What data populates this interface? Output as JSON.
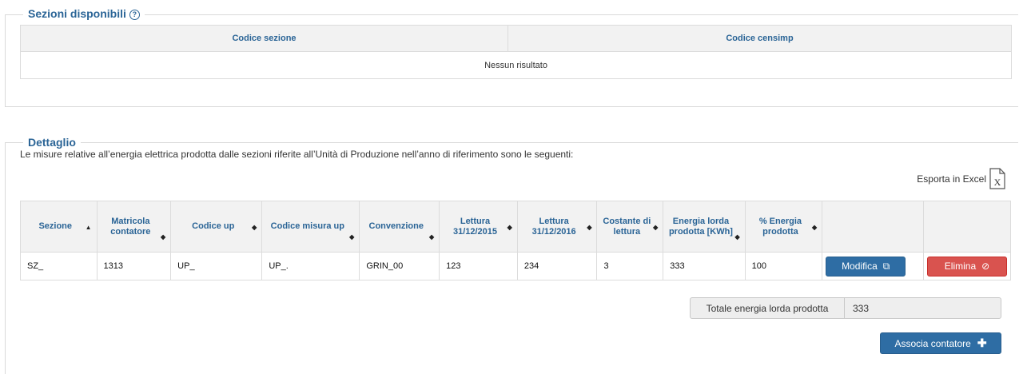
{
  "sezioni": {
    "legend": "Sezioni disponibili",
    "help_icon": "question-circle-icon",
    "headers": [
      "Codice sezione",
      "Codice censimp"
    ],
    "empty_text": "Nessun risultato"
  },
  "dettaglio": {
    "legend": "Dettaglio",
    "description": "Le misure relative all’energia elettrica prodotta dalle sezioni riferite all’Unità di Produzione nell’anno di riferimento sono le seguenti:",
    "export_label": "Esporta in Excel",
    "export_icon": "excel-file-icon",
    "headers": [
      "Sezione",
      "Matricola contatore",
      "Codice up",
      "Codice misura up",
      "Convenzione",
      "Lettura 31/12/2015",
      "Lettura 31/12/2016",
      "Costante di lettura",
      "Energia lorda prodotta [KWh]",
      "% Energia prodotta"
    ],
    "rows": [
      {
        "sezione": "SZ_",
        "matricola": "1313",
        "codice_up": "UP_",
        "codice_misura_up": "UP_.",
        "convenzione": "GRIN_00",
        "lettura_2015": "123",
        "lettura_2016": "234",
        "costante": "3",
        "energia_lorda": "333",
        "perc_energia": "100",
        "modifica_label": "Modifica",
        "elimina_label": "Elimina"
      }
    ],
    "totale_label": "Totale energia lorda prodotta",
    "totale_value": "333",
    "associa_label": "Associa contatore"
  },
  "colors": {
    "primary": "#2e6da4",
    "danger": "#d9534f",
    "header_text": "#2a6496"
  }
}
